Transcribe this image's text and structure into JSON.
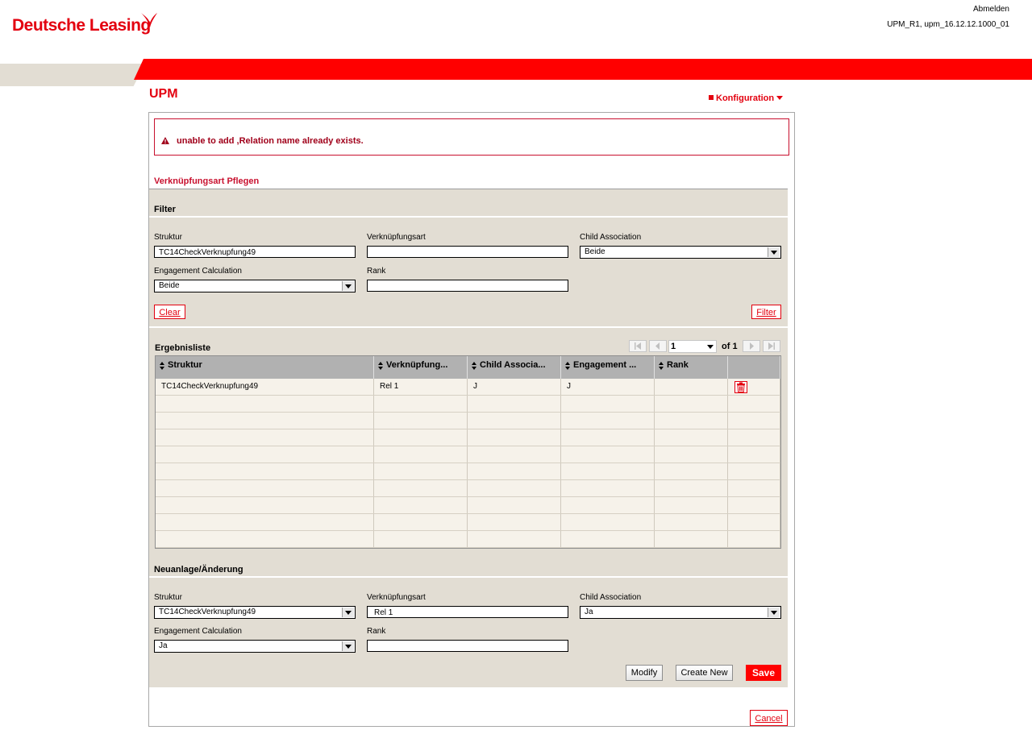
{
  "header": {
    "logo_text": "Deutsche Leasing",
    "logout": "Abmelden",
    "version": "UPM_R1, upm_16.12.12.1000_01",
    "app_title": "UPM",
    "menu_config": "Konfiguration"
  },
  "error": {
    "message": "unable to add ,Relation name already exists."
  },
  "page": {
    "section_title": "Verknüpfungsart Pflegen"
  },
  "filter": {
    "title": "Filter",
    "struktur_label": "Struktur",
    "struktur_value": "TC14CheckVerknupfung49",
    "verknuepfungsart_label": "Verknüpfungsart",
    "verknuepfungsart_value": "",
    "child_assoc_label": "Child Association",
    "child_assoc_value": "Beide",
    "engagement_label": "Engagement Calculation",
    "engagement_value": "Beide",
    "rank_label": "Rank",
    "rank_value": "",
    "clear_button": "Clear",
    "filter_button": "Filter"
  },
  "results": {
    "title": "Ergebnisliste",
    "pager": {
      "page": "1",
      "of_text": "of 1"
    },
    "columns": [
      "Struktur",
      "Verknüpfung...",
      "Child Associa...",
      "Engagement ...",
      "Rank"
    ],
    "rows": [
      [
        "TC14CheckVerknupfung49",
        "Rel 1",
        "J",
        "J",
        ""
      ]
    ],
    "empty_row_count": 9
  },
  "edit": {
    "title": "Neuanlage/Änderung",
    "struktur_label": "Struktur",
    "struktur_value": "TC14CheckVerknupfung49",
    "verknuepfungsart_label": "Verknüpfungsart",
    "verknuepfungsart_value": "Rel 1",
    "child_assoc_label": "Child Association",
    "child_assoc_value": "Ja",
    "engagement_label": "Engagement Calculation",
    "engagement_value": "Ja",
    "rank_label": "Rank",
    "rank_value": "",
    "modify_button": "Modify",
    "create_button": "Create New",
    "save_button": "Save"
  },
  "footer": {
    "cancel_button": "Cancel"
  },
  "colors": {
    "brand_red": "#e3000f",
    "beige": "#e2ddd3",
    "header_grey": "#b1b1b1"
  }
}
